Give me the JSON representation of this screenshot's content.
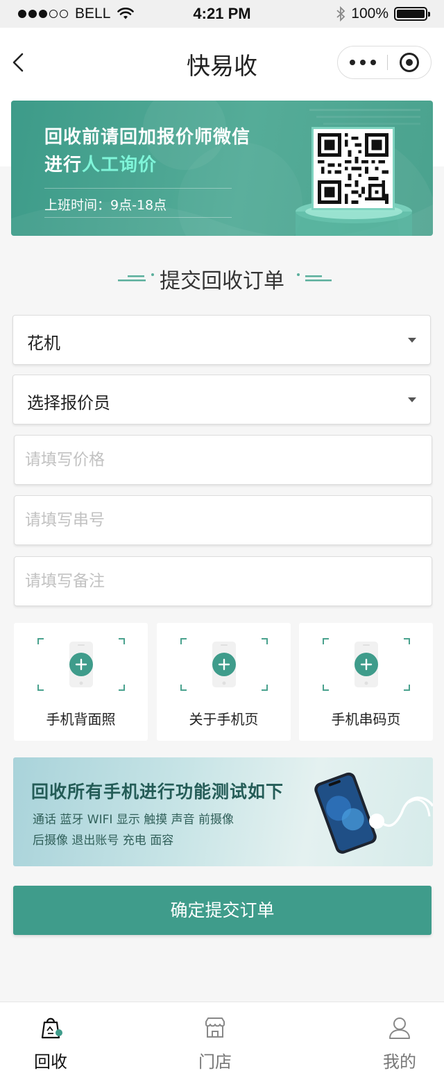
{
  "status_bar": {
    "carrier": "BELL",
    "time": "4:21 PM",
    "battery": "100%"
  },
  "nav": {
    "title": "快易收"
  },
  "banner": {
    "line1": "回收前请回加报价师微信",
    "line2_prefix": "进行",
    "line2_highlight": "人工询价",
    "hours": "上班时间：9点-18点",
    "highlight_color": "#7ff5d9"
  },
  "section": {
    "title": "提交回收订单"
  },
  "form": {
    "category_value": "花机",
    "quoter_value": "选择报价员",
    "price_placeholder": "请填写价格",
    "serial_placeholder": "请填写串号",
    "note_placeholder": "请填写备注"
  },
  "photos": [
    {
      "label": "手机背面照"
    },
    {
      "label": "关于手机页"
    },
    {
      "label": "手机串码页"
    }
  ],
  "test_banner": {
    "title": "回收所有手机进行功能测试如下",
    "line1": "通话 蓝牙 WIFI 显示 触摸 声音 前摄像",
    "line2": "后摄像 退出账号 充电 面容"
  },
  "submit": {
    "label": "确定提交订单"
  },
  "tabbar": {
    "items": [
      {
        "label": "回收",
        "icon": "recycle-bag-icon",
        "active": true
      },
      {
        "label": "门店",
        "icon": "store-icon",
        "active": false
      },
      {
        "label": "我的",
        "icon": "user-icon",
        "active": false
      }
    ]
  },
  "colors": {
    "primary": "#3f9c8b",
    "banner_bg": "#4aa28e"
  }
}
